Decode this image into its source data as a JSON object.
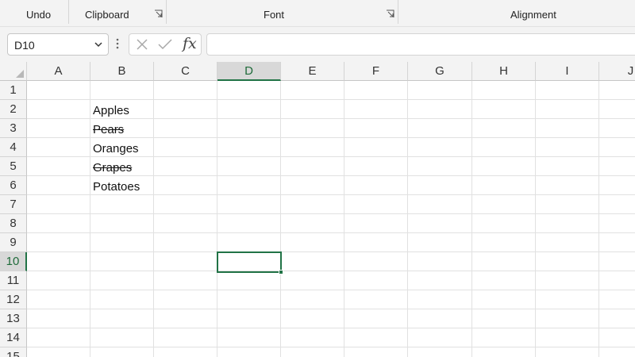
{
  "ribbon": {
    "groups": [
      "Undo",
      "Clipboard",
      "Font",
      "Alignment"
    ]
  },
  "formula_bar": {
    "name_box": "D10",
    "fx_label": "fx",
    "formula_value": ""
  },
  "sheet": {
    "columns": [
      "A",
      "B",
      "C",
      "D",
      "E",
      "F",
      "G",
      "H",
      "I",
      "J"
    ],
    "rows": [
      "1",
      "2",
      "3",
      "4",
      "5",
      "6",
      "7",
      "8",
      "9",
      "10",
      "11",
      "12",
      "13",
      "14",
      "15"
    ],
    "selected_cell": "D10",
    "cells": {
      "B2": "Apples",
      "B3": "Pears",
      "B4": "Oranges",
      "B5": "Grapes",
      "B6": "Potatoes"
    },
    "strikethrough": [
      "B3",
      "B5"
    ]
  },
  "colors": {
    "accent": "#217346",
    "header_bg": "#f3f3f3",
    "gridline": "#e1e1e1"
  }
}
